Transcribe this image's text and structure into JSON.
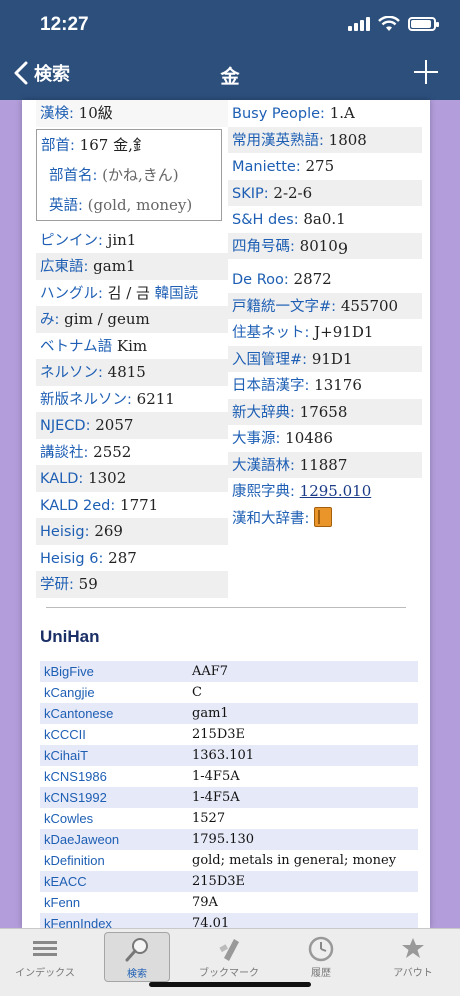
{
  "status": {
    "time": "12:27"
  },
  "nav": {
    "back_label": "検索",
    "title": "金"
  },
  "left": {
    "kanken": {
      "label": "漢検:",
      "value": "10級"
    },
    "bushu": {
      "label": "部首:",
      "value": "167 金,釒"
    },
    "bushumei": {
      "label": "部首名:",
      "value": "(かね,きん)"
    },
    "eigo": {
      "label": "英語:",
      "value": "(gold, money)"
    },
    "pinyin": {
      "label": "ピンイン:",
      "value": "jin1"
    },
    "cantonese": {
      "label": "広東語:",
      "value": "gam1"
    },
    "hangul": {
      "label": "ハングル:",
      "value": "김 / 금",
      "link": "韓国読"
    },
    "hangul2": {
      "label": "み:",
      "value": "gim / geum"
    },
    "vietnamese": {
      "label": "ベトナム語",
      "value": "Kim"
    },
    "nelson": {
      "label": "ネルソン:",
      "value": "4815"
    },
    "newnelson": {
      "label": "新版ネルソン:",
      "value": "6211"
    },
    "njecd": {
      "label": "NJECD:",
      "value": "2057"
    },
    "kodansha": {
      "label": "講談社:",
      "value": "2552"
    },
    "kald": {
      "label": "KALD:",
      "value": "1302"
    },
    "kald2": {
      "label": "KALD 2ed:",
      "value": "1771"
    },
    "heisig": {
      "label": "Heisig:",
      "value": "269"
    },
    "heisig6": {
      "label": "Heisig 6:",
      "value": "287"
    },
    "gakken": {
      "label": "学研:",
      "value": "59"
    }
  },
  "right": {
    "busy": {
      "label": "Busy People:",
      "value": "1.A"
    },
    "joyo": {
      "label": "常用漢英熟語:",
      "value": "1808"
    },
    "maniette": {
      "label": "Maniette:",
      "value": "275"
    },
    "skip": {
      "label": "SKIP:",
      "value": "2-2-6"
    },
    "sh": {
      "label": "S&H des:",
      "value": "8a0.1"
    },
    "shikaku": {
      "label": "四角号碼:",
      "value": "8010",
      "sub": "9"
    },
    "deroo": {
      "label": "De Roo:",
      "value": "2872"
    },
    "koseki": {
      "label": "戸籍統一文字#:",
      "value": "455700"
    },
    "juki": {
      "label": "住基ネット:",
      "value": "J+91D1"
    },
    "nyukoku": {
      "label": "入国管理#:",
      "value": "91D1"
    },
    "nihongo": {
      "label": "日本語漢字:",
      "value": "13176"
    },
    "shindaijiten": {
      "label": "新大辞典:",
      "value": "17658"
    },
    "daijigen": {
      "label": "大事源:",
      "value": "10486"
    },
    "daikango": {
      "label": "大漢語林:",
      "value": "11887"
    },
    "kangxi": {
      "label": "康熙字典:",
      "value": "1295.010"
    },
    "kanwa": {
      "label": "漢和大辞書:"
    }
  },
  "unihan": {
    "title": "UniHan",
    "rows": [
      {
        "k": "kBigFive",
        "v": "AAF7"
      },
      {
        "k": "kCangjie",
        "v": "C"
      },
      {
        "k": "kCantonese",
        "v": "gam1"
      },
      {
        "k": "kCCCII",
        "v": "215D3E"
      },
      {
        "k": "kCihaiT",
        "v": "1363.101"
      },
      {
        "k": "kCNS1986",
        "v": "1-4F5A"
      },
      {
        "k": "kCNS1992",
        "v": "1-4F5A"
      },
      {
        "k": "kCowles",
        "v": "1527"
      },
      {
        "k": "kDaeJaweon",
        "v": "1795.130"
      },
      {
        "k": "kDefinition",
        "v": "gold; metals in general; money"
      },
      {
        "k": "kEACC",
        "v": "215D3E"
      },
      {
        "k": "kFenn",
        "v": "79A"
      },
      {
        "k": "kFennIndex",
        "v": "74.01"
      }
    ]
  },
  "tabs": [
    {
      "label": "インデックス",
      "icon": "list-icon"
    },
    {
      "label": "検索",
      "icon": "magnifier-icon"
    },
    {
      "label": "ブックマーク",
      "icon": "bookmark-icon"
    },
    {
      "label": "履歴",
      "icon": "clock-icon"
    },
    {
      "label": "アバウト",
      "icon": "about-icon"
    }
  ],
  "colors": {
    "nav": "#2c4f7c",
    "label": "#1e5fb4",
    "background": "#b39ddb"
  }
}
